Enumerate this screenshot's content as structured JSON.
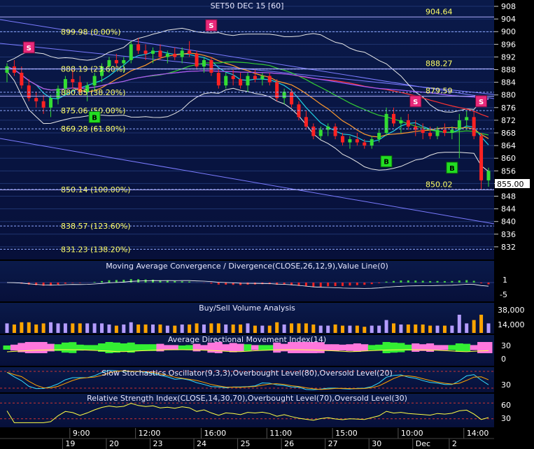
{
  "chart_data": [
    {
      "type": "candlestick",
      "title": "SET50 DEC 15   [60]",
      "ylim": [
        828,
        910
      ],
      "y_ticks": [
        832,
        836,
        840,
        844,
        848,
        852,
        856,
        860,
        864,
        868,
        872,
        876,
        880,
        884,
        888,
        892,
        896,
        900,
        904,
        908
      ],
      "last_price": "855.00",
      "candles": [
        {
          "o": 887,
          "h": 890,
          "l": 884,
          "c": 889
        },
        {
          "o": 889,
          "h": 891,
          "l": 886,
          "c": 887
        },
        {
          "o": 887,
          "h": 889,
          "l": 882,
          "c": 883
        },
        {
          "o": 883,
          "h": 885,
          "l": 878,
          "c": 879
        },
        {
          "o": 879,
          "h": 881,
          "l": 876,
          "c": 878
        },
        {
          "o": 878,
          "h": 880,
          "l": 874,
          "c": 876
        },
        {
          "o": 876,
          "h": 880,
          "l": 873,
          "c": 879
        },
        {
          "o": 879,
          "h": 883,
          "l": 877,
          "c": 882
        },
        {
          "o": 882,
          "h": 886,
          "l": 880,
          "c": 885
        },
        {
          "o": 885,
          "h": 888,
          "l": 882,
          "c": 884
        },
        {
          "o": 884,
          "h": 886,
          "l": 880,
          "c": 881
        },
        {
          "o": 881,
          "h": 884,
          "l": 878,
          "c": 883
        },
        {
          "o": 883,
          "h": 887,
          "l": 881,
          "c": 886
        },
        {
          "o": 886,
          "h": 890,
          "l": 884,
          "c": 889
        },
        {
          "o": 889,
          "h": 892,
          "l": 887,
          "c": 891
        },
        {
          "o": 891,
          "h": 893,
          "l": 889,
          "c": 890
        },
        {
          "o": 890,
          "h": 892,
          "l": 887,
          "c": 891
        },
        {
          "o": 891,
          "h": 897,
          "l": 890,
          "c": 896
        },
        {
          "o": 896,
          "h": 898,
          "l": 893,
          "c": 894
        },
        {
          "o": 894,
          "h": 896,
          "l": 891,
          "c": 893
        },
        {
          "o": 893,
          "h": 895,
          "l": 890,
          "c": 894
        },
        {
          "o": 894,
          "h": 896,
          "l": 891,
          "c": 892
        },
        {
          "o": 892,
          "h": 894,
          "l": 890,
          "c": 893
        },
        {
          "o": 893,
          "h": 895,
          "l": 891,
          "c": 892
        },
        {
          "o": 892,
          "h": 895,
          "l": 890,
          "c": 894
        },
        {
          "o": 894,
          "h": 897,
          "l": 892,
          "c": 893
        },
        {
          "o": 893,
          "h": 894,
          "l": 888,
          "c": 889
        },
        {
          "o": 889,
          "h": 892,
          "l": 887,
          "c": 891
        },
        {
          "o": 891,
          "h": 892,
          "l": 886,
          "c": 887
        },
        {
          "o": 887,
          "h": 888,
          "l": 882,
          "c": 883
        },
        {
          "o": 883,
          "h": 887,
          "l": 882,
          "c": 886
        },
        {
          "o": 886,
          "h": 888,
          "l": 883,
          "c": 885
        },
        {
          "o": 885,
          "h": 887,
          "l": 882,
          "c": 883
        },
        {
          "o": 883,
          "h": 887,
          "l": 881,
          "c": 886
        },
        {
          "o": 886,
          "h": 888,
          "l": 884,
          "c": 885
        },
        {
          "o": 885,
          "h": 887,
          "l": 883,
          "c": 886
        },
        {
          "o": 886,
          "h": 887,
          "l": 883,
          "c": 884
        },
        {
          "o": 884,
          "h": 885,
          "l": 878,
          "c": 879
        },
        {
          "o": 879,
          "h": 882,
          "l": 877,
          "c": 881
        },
        {
          "o": 881,
          "h": 882,
          "l": 876,
          "c": 877
        },
        {
          "o": 877,
          "h": 878,
          "l": 872,
          "c": 873
        },
        {
          "o": 873,
          "h": 875,
          "l": 869,
          "c": 870
        },
        {
          "o": 870,
          "h": 871,
          "l": 866,
          "c": 867
        },
        {
          "o": 867,
          "h": 870,
          "l": 866,
          "c": 869
        },
        {
          "o": 869,
          "h": 871,
          "l": 867,
          "c": 870
        },
        {
          "o": 870,
          "h": 871,
          "l": 866,
          "c": 867
        },
        {
          "o": 867,
          "h": 868,
          "l": 864,
          "c": 865
        },
        {
          "o": 865,
          "h": 867,
          "l": 863,
          "c": 866
        },
        {
          "o": 866,
          "h": 868,
          "l": 864,
          "c": 865
        },
        {
          "o": 865,
          "h": 866,
          "l": 863,
          "c": 864
        },
        {
          "o": 864,
          "h": 867,
          "l": 863,
          "c": 866
        },
        {
          "o": 866,
          "h": 869,
          "l": 865,
          "c": 868
        },
        {
          "o": 868,
          "h": 876,
          "l": 867,
          "c": 874
        },
        {
          "o": 874,
          "h": 876,
          "l": 870,
          "c": 871
        },
        {
          "o": 871,
          "h": 873,
          "l": 868,
          "c": 872
        },
        {
          "o": 872,
          "h": 874,
          "l": 869,
          "c": 870
        },
        {
          "o": 870,
          "h": 872,
          "l": 867,
          "c": 869
        },
        {
          "o": 869,
          "h": 871,
          "l": 866,
          "c": 868
        },
        {
          "o": 868,
          "h": 870,
          "l": 866,
          "c": 867
        },
        {
          "o": 867,
          "h": 870,
          "l": 866,
          "c": 869
        },
        {
          "o": 869,
          "h": 871,
          "l": 867,
          "c": 868
        },
        {
          "o": 868,
          "h": 870,
          "l": 866,
          "c": 869
        },
        {
          "o": 869,
          "h": 874,
          "l": 860,
          "c": 872
        },
        {
          "o": 872,
          "h": 875,
          "l": 869,
          "c": 873
        },
        {
          "o": 873,
          "h": 875,
          "l": 866,
          "c": 867
        },
        {
          "o": 867,
          "h": 868,
          "l": 850,
          "c": 853
        },
        {
          "o": 853,
          "h": 857,
          "l": 851,
          "c": 856
        }
      ],
      "fib_levels": [
        {
          "value": 899.98,
          "label": "899.98 (0.00%)"
        },
        {
          "value": 888.19,
          "label": "888.19 (23.60%)"
        },
        {
          "value": 880.85,
          "label": "880.85 (38.20%)"
        },
        {
          "value": 875.06,
          "label": "875.06 (50.00%)"
        },
        {
          "value": 869.28,
          "label": "869.28 (61.80%)"
        },
        {
          "value": 850.14,
          "label": "850.14 (100.00%)"
        },
        {
          "value": 838.57,
          "label": "838.57 (123.60%)"
        },
        {
          "value": 831.23,
          "label": "831.23 (138.20%)"
        }
      ],
      "levels": [
        {
          "value": 904.64,
          "label": "904.64"
        },
        {
          "value": 888.27,
          "label": "888.27"
        },
        {
          "value": 879.59,
          "label": "879.59"
        },
        {
          "value": 850.02,
          "label": "850.02"
        }
      ],
      "signals": [
        {
          "i": 3,
          "type": "S",
          "price": 895
        },
        {
          "i": 12,
          "type": "B",
          "price": 873
        },
        {
          "i": 28,
          "type": "S",
          "price": 902
        },
        {
          "i": 52,
          "type": "B",
          "price": 859
        },
        {
          "i": 56,
          "type": "S",
          "price": 878
        },
        {
          "i": 61,
          "type": "B",
          "price": 857
        },
        {
          "i": 65,
          "type": "S",
          "price": 878
        }
      ]
    },
    {
      "type": "histogram",
      "title": "Moving Average Convergence / Divergence(CLOSE,26,12,9),Value Line(0)",
      "y_ticks": [
        1,
        -5
      ]
    },
    {
      "type": "bar",
      "title": "Buy/Sell Volume Analysis",
      "y_ticks": [
        "38,000",
        "14,000"
      ]
    },
    {
      "type": "area",
      "title": "Average Directional Movement Index(14)",
      "y_ticks": [
        30,
        0
      ]
    },
    {
      "type": "line",
      "title": "Slow Stochastics Oscillator(9,3,3),Overbought Level(80),Oversold Level(20)",
      "y_ticks": [
        30
      ]
    },
    {
      "type": "line",
      "title": "Relative Strength Index(CLOSE,14,30,70),Overbought Level(70),Oversold Level(30)",
      "y_ticks": [
        60,
        30
      ]
    }
  ],
  "time_axis": {
    "hours": [
      {
        "i": 9,
        "label": "9:00"
      },
      {
        "i": 18,
        "label": "12:00"
      },
      {
        "i": 27,
        "label": "16:00"
      },
      {
        "i": 36,
        "label": "11:00"
      },
      {
        "i": 45,
        "label": "15:00"
      },
      {
        "i": 54,
        "label": "10:00"
      },
      {
        "i": 63,
        "label": "14:00"
      }
    ],
    "days": [
      {
        "i": 8,
        "label": "19"
      },
      {
        "i": 14,
        "label": "20"
      },
      {
        "i": 20,
        "label": "23"
      },
      {
        "i": 26,
        "label": "24"
      },
      {
        "i": 32,
        "label": "25"
      },
      {
        "i": 38,
        "label": "26"
      },
      {
        "i": 44,
        "label": "27"
      },
      {
        "i": 50,
        "label": "30"
      },
      {
        "i": 56,
        "label": "Dec"
      },
      {
        "i": 61,
        "label": "2"
      }
    ]
  }
}
